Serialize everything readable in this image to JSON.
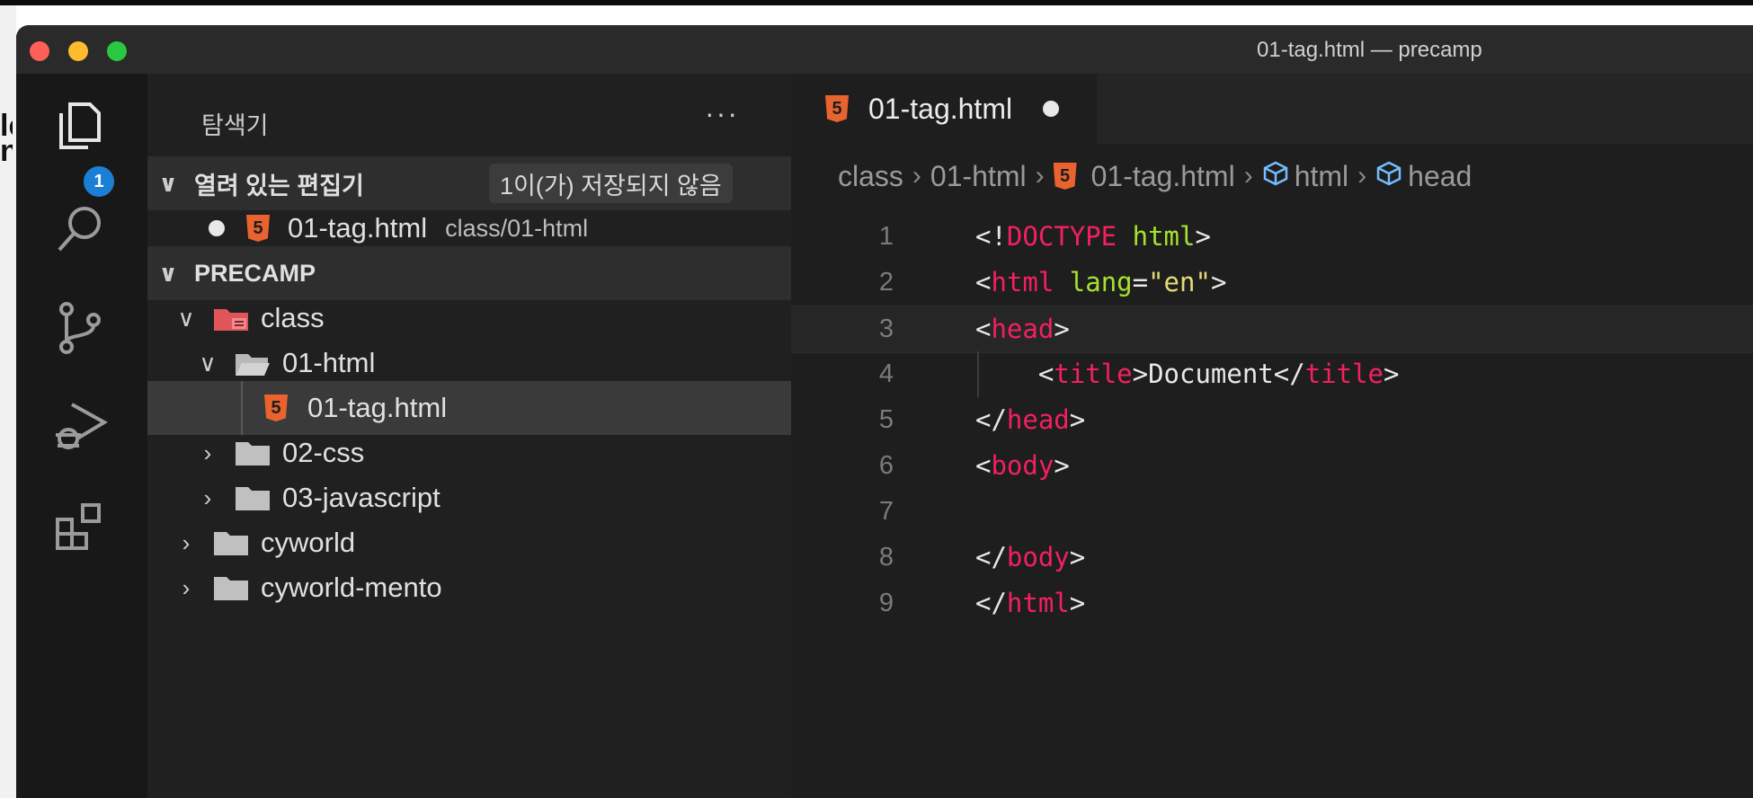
{
  "window": {
    "title": "01-tag.html — precamp"
  },
  "activity_bar": {
    "items": [
      {
        "name": "explorer",
        "icon": "files-icon"
      },
      {
        "name": "search",
        "icon": "search-icon"
      },
      {
        "name": "source-control",
        "icon": "source-control-icon"
      },
      {
        "name": "run-debug",
        "icon": "run-debug-icon"
      },
      {
        "name": "extensions",
        "icon": "extensions-icon"
      }
    ],
    "explorer_badge": "1"
  },
  "sidebar": {
    "title": "탐색기",
    "more": "···",
    "open_editors": {
      "label": "열려 있는 편집기",
      "unsaved": "1이(가) 저장되지 않음",
      "files": [
        {
          "name": "01-tag.html",
          "path": "class/01-html"
        }
      ]
    },
    "workspace": {
      "label": "PRECAMP",
      "tree": {
        "class": "class",
        "html_folder": "01-html",
        "html_file": "01-tag.html",
        "css_folder": "02-css",
        "js_folder": "03-javascript",
        "cyworld": "cyworld",
        "cyworld_mento": "cyworld-mento"
      }
    }
  },
  "editor": {
    "tab": {
      "label": "01-tag.html"
    },
    "breadcrumb": [
      "class",
      "01-html",
      "01-tag.html",
      "html",
      "head"
    ],
    "line_numbers": [
      "1",
      "2",
      "3",
      "4",
      "5",
      "6",
      "7",
      "8",
      "9"
    ],
    "code_lines": [
      "<!DOCTYPE html>",
      "<html lang=\"en\">",
      "<head>",
      "    <title>Document</title>",
      "</head>",
      "<body>",
      "",
      "</body>",
      "</html>"
    ],
    "current_line": 3
  },
  "colors": {
    "tag": "#f3205f",
    "attribute": "#a6e22e",
    "string": "#e6db74",
    "html_icon": "#e9632e",
    "badge": "#1c7fd6",
    "class_folder": "#e0555a"
  }
}
